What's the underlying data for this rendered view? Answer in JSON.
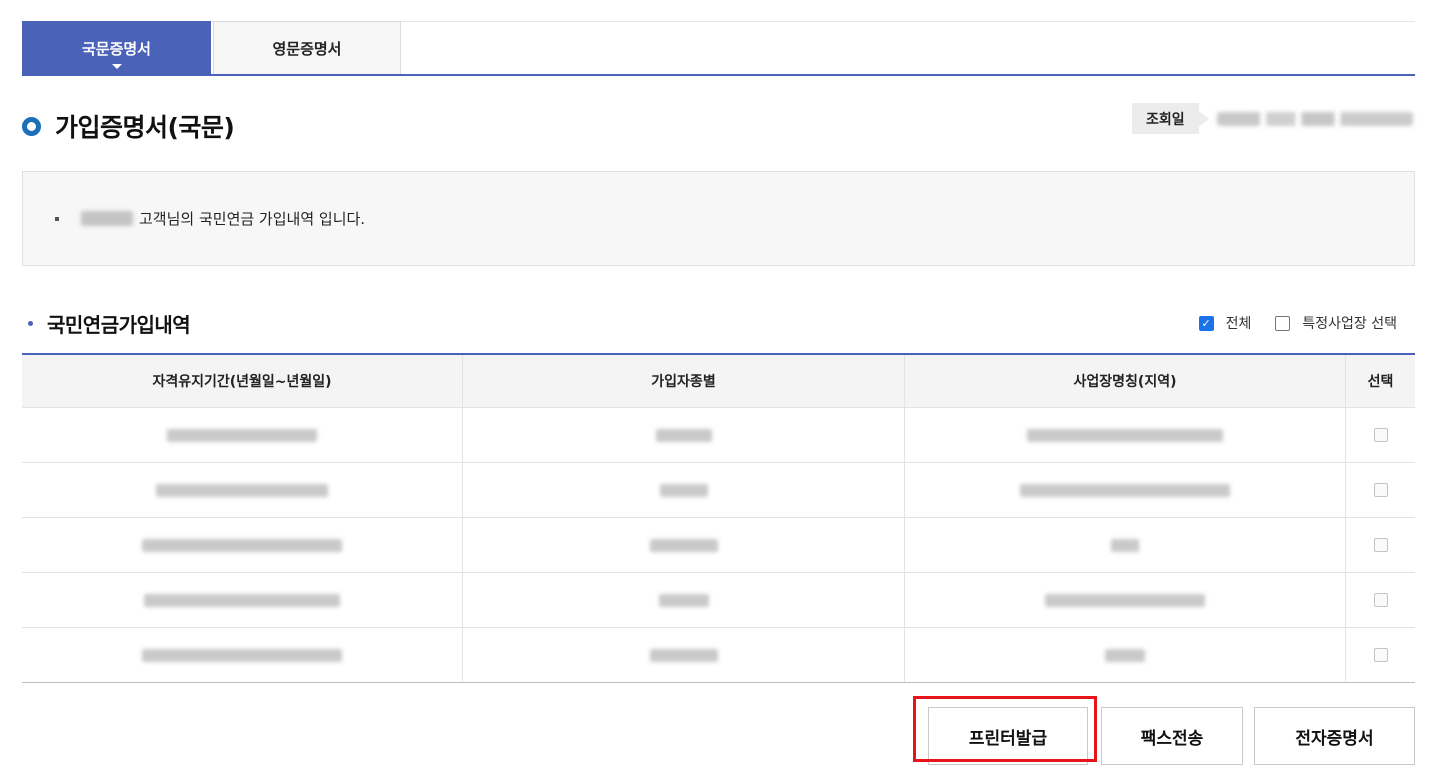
{
  "tabs": [
    {
      "label": "국문증명서",
      "active": true
    },
    {
      "label": "영문증명서",
      "active": false
    }
  ],
  "title": "가입증명서(국문)",
  "date_label": "조회일",
  "info_text": "고객님의 국민연금 가입내역 입니다.",
  "section_title": "국민연금가입내역",
  "filters": {
    "all_label": "전체",
    "all_checked": true,
    "specific_label": "특정사업장 선택",
    "specific_checked": false
  },
  "table": {
    "headers": [
      "자격유지기간(년월일~년월일)",
      "가입자종별",
      "사업장명칭(지역)",
      "선택"
    ],
    "rows": [
      {
        "selected": false
      },
      {
        "selected": false
      },
      {
        "selected": false
      },
      {
        "selected": false
      },
      {
        "selected": false
      }
    ]
  },
  "buttons": {
    "print": "프린터발급",
    "fax": "팩스전송",
    "edoc": "전자증명서"
  },
  "colors": {
    "accent": "#4a62b8",
    "title_icon": "#1d6fb8",
    "highlight": "#e8141a",
    "checkbox": "#1a73e8"
  }
}
